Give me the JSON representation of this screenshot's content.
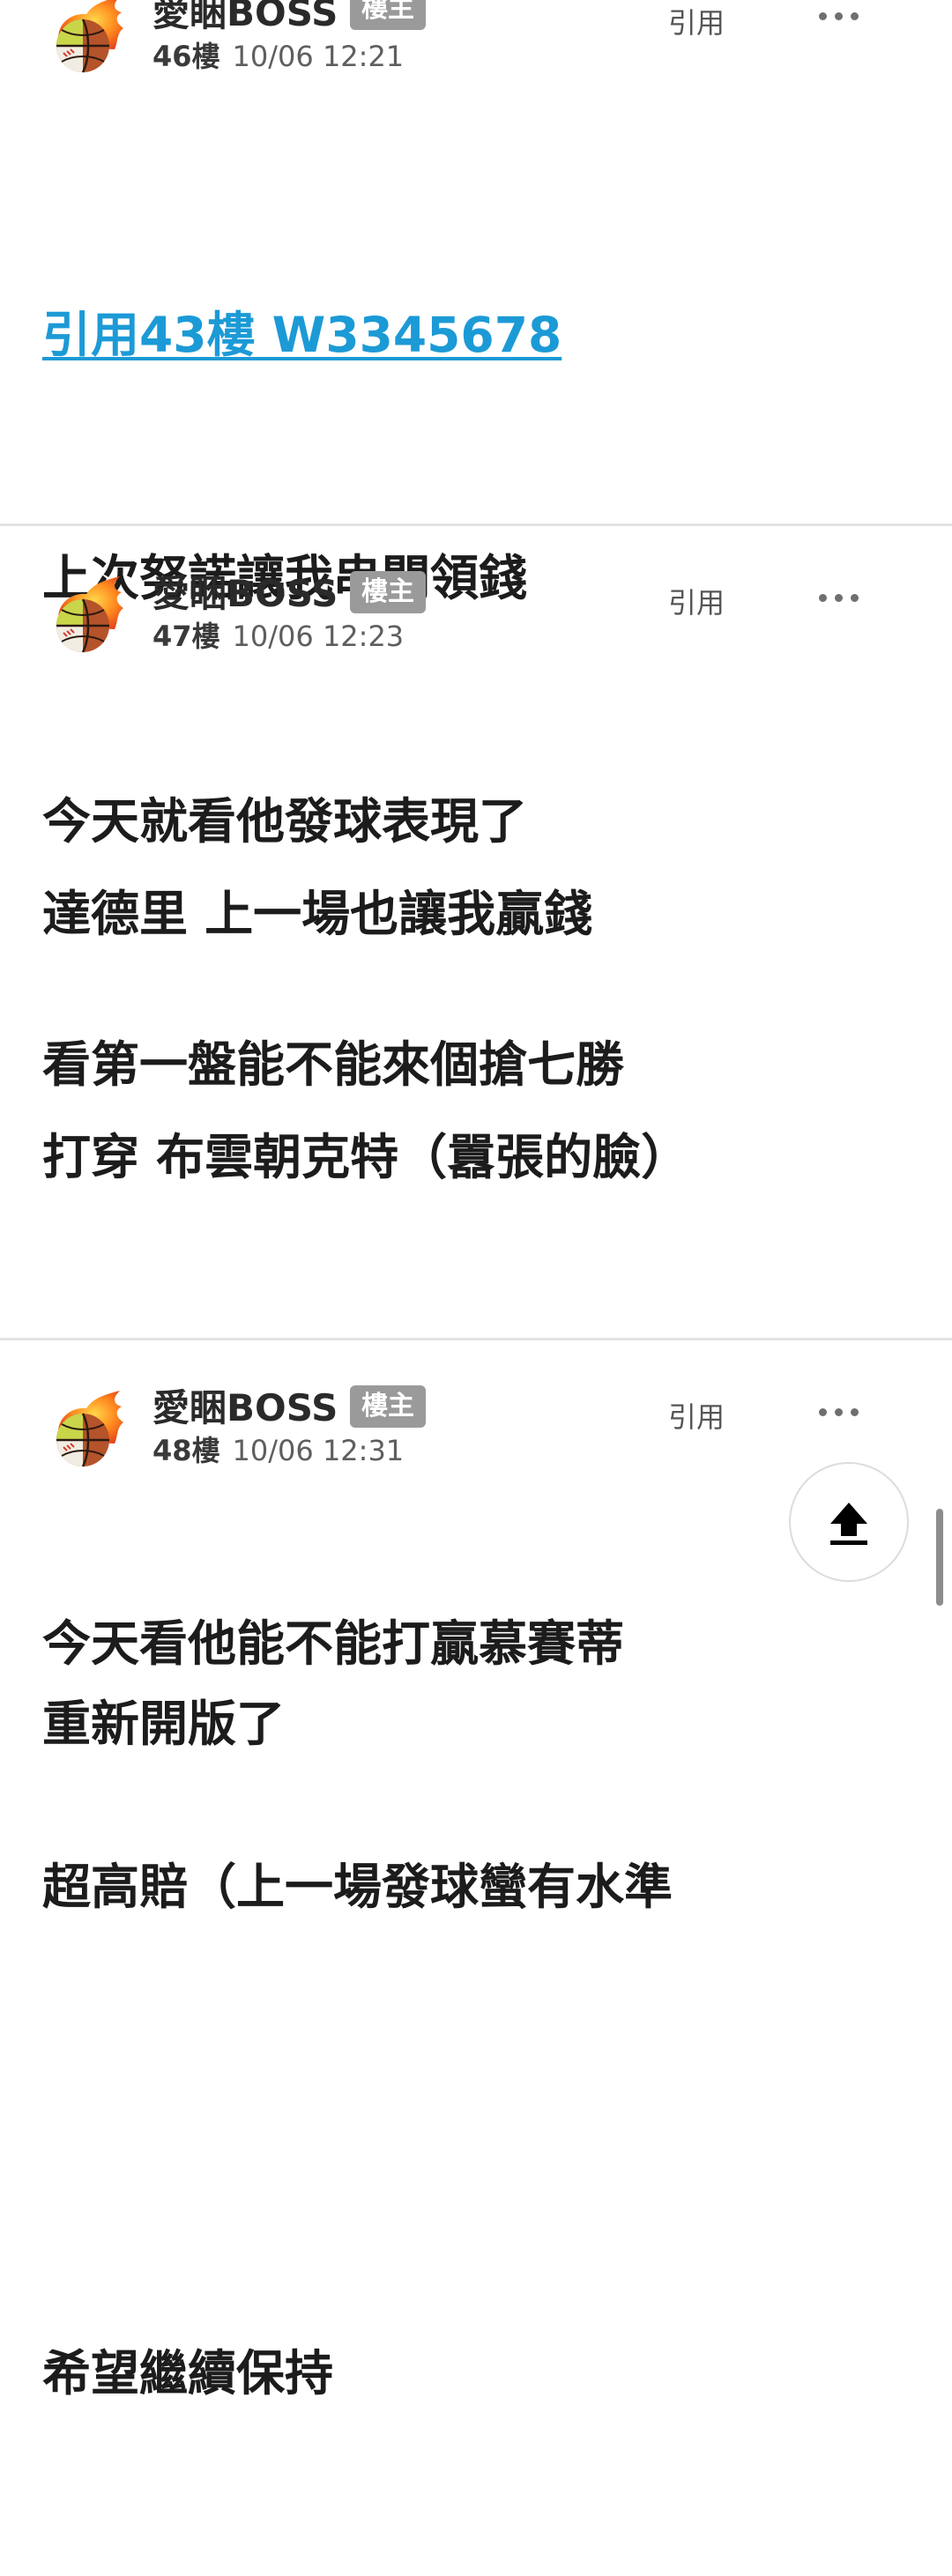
{
  "posts": [
    {
      "author": "愛睏BOSS",
      "badge": "樓主",
      "floor": "46樓",
      "datetime": "10/06 12:21",
      "quote_label": "引用",
      "quote_link": "引用43樓 W3345678",
      "lines": [
        "上次努諾讓我串關領錢",
        "今天就看他發球表現了",
        "看第一盤能不能來個搶七勝"
      ]
    },
    {
      "author": "愛睏BOSS",
      "badge": "樓主",
      "floor": "47樓",
      "datetime": "10/06 12:23",
      "quote_label": "引用",
      "lines": [
        "達德里 上一場也讓我贏錢",
        "打穿 布雲朝克特（囂張的臉）",
        "",
        "今天看他能不能打贏慕賽蒂",
        "超高賠（上一場發球蠻有水準",
        "",
        "希望繼續保持"
      ]
    },
    {
      "author": "愛睏BOSS",
      "badge": "樓主",
      "floor": "48樓",
      "datetime": "10/06 12:31",
      "quote_label": "引用",
      "lines": [
        "重新開版了"
      ]
    }
  ],
  "icons": {
    "avatar": "flaming-ball-avatar-icon",
    "more": "more-dots-icon",
    "scroll_top": "arrow-up-to-top-icon"
  },
  "colors": {
    "link": "#1c9ad6",
    "badge_bg": "#9a9a9a",
    "divider": "#e3e3e3"
  }
}
